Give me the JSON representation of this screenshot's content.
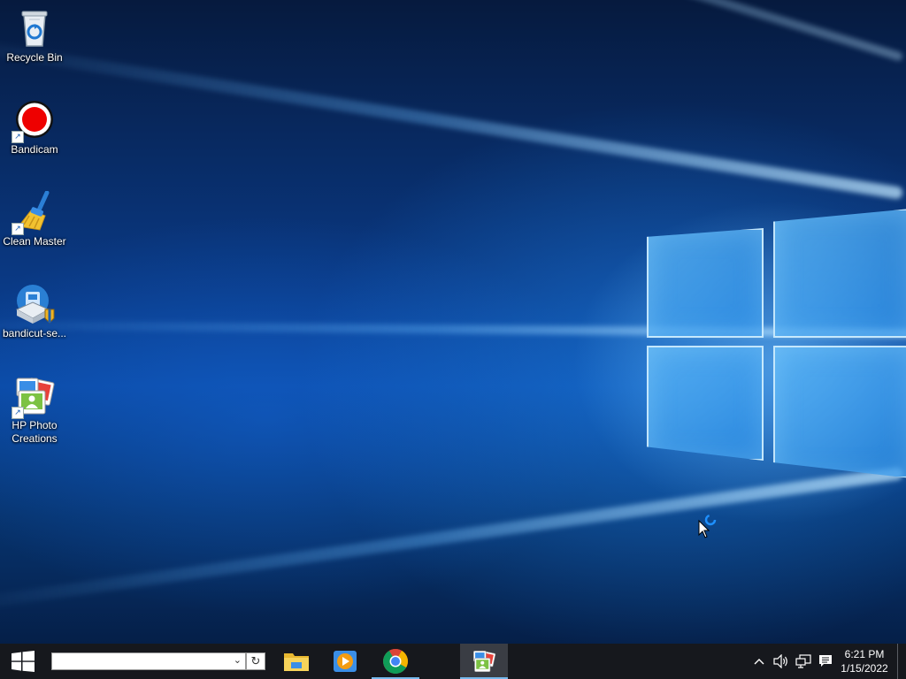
{
  "desktop": {
    "icons": [
      {
        "label": "Recycle Bin",
        "icon": "recycle-bin-icon"
      },
      {
        "label": "Bandicam",
        "icon": "bandicam-icon"
      },
      {
        "label": "Clean Master",
        "icon": "clean-master-icon"
      },
      {
        "label": "bandicut-se...",
        "icon": "bandicut-setup-icon"
      },
      {
        "label": "HP Photo Creations",
        "icon": "hp-photo-creations-icon"
      }
    ]
  },
  "taskbar": {
    "start_icon": "windows-start-icon",
    "search": {
      "value": "",
      "placeholder": ""
    },
    "pinned": [
      {
        "icon": "file-explorer-icon"
      },
      {
        "icon": "media-player-icon"
      },
      {
        "icon": "chrome-icon"
      },
      {
        "icon": "hp-photo-creations-icon"
      }
    ],
    "tray": {
      "icons": [
        "chevron-up-icon",
        "volume-icon",
        "network-icon",
        "notifications-icon"
      ],
      "time": "6:21 PM",
      "date": "1/15/2022"
    }
  },
  "colors": {
    "taskbar": "#16181d",
    "accent": "#0078d7"
  }
}
